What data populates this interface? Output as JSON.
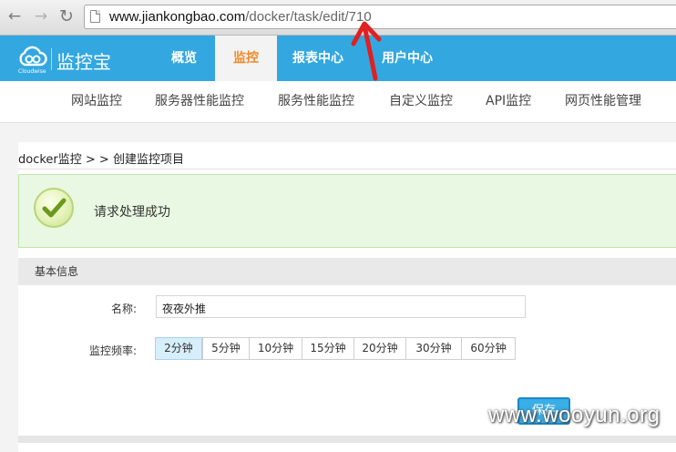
{
  "browser": {
    "back_icon": "arrow-left-icon",
    "forward_icon": "arrow-right-icon",
    "reload_icon": "reload-icon",
    "url_host": "www.jiankongbao.com",
    "url_path": "/docker/task/edit/710"
  },
  "header": {
    "logo_text": "监控宝",
    "logo_sub": "Cloudwise",
    "nav": [
      "概览",
      "监控",
      "报表中心",
      "用户中心"
    ],
    "active_nav": "监控",
    "accent_color": "#33a7e0",
    "active_color": "#f08a2a"
  },
  "subnav": [
    "网站监控",
    "服务器性能监控",
    "服务性能监控",
    "自定义监控",
    "API监控",
    "网页性能管理"
  ],
  "breadcrumb": "docker监控 > > 创建监控项目",
  "alert": {
    "icon": "check-icon",
    "message": "请求处理成功"
  },
  "form": {
    "section_title": "基本信息",
    "name_label": "名称:",
    "name_value": "夜夜外推",
    "freq_label": "监控频率:",
    "freq_options": [
      "2分钟",
      "5分钟",
      "10分钟",
      "15分钟",
      "20分钟",
      "30分钟",
      "60分钟"
    ],
    "freq_selected": "2分钟",
    "save_label": "保存"
  },
  "annotation": {
    "arrow_color": "#e02020"
  },
  "watermark": "www.wooyun.org"
}
